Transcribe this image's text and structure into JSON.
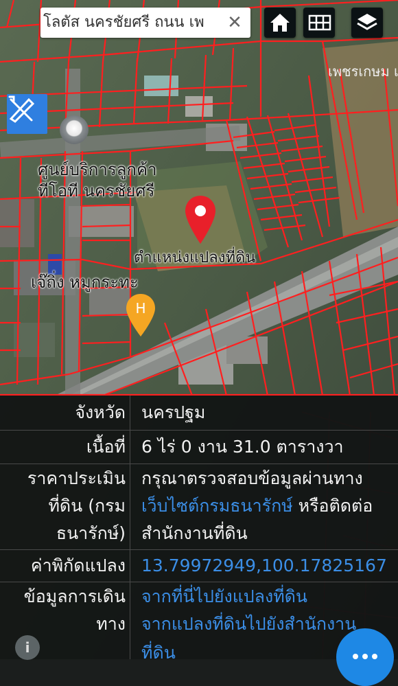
{
  "search": {
    "value": "โลตัส นครชัยศรี ถนน เพ",
    "clear_label": "✕"
  },
  "toolbar": {
    "home_icon": "home-icon",
    "grid_icon": "grid-icon",
    "layers_icon": "layers-icon"
  },
  "map": {
    "labels": {
      "poi_a_line1": "ศูนย์บริการลูกค้า",
      "poi_a_line2": "ทีโอที นครชัยศรี",
      "parcel_label": "ตำแหน่งแปลงที่ดิน",
      "poi_b": "เจ๊ถิ่ง หมูกระทะ",
      "road_top": "เพชรเกษม เพ"
    },
    "colors": {
      "parcel_lines": "#ff1f1f",
      "pin_red": "#e8202a",
      "pin_yellow": "#f5a623",
      "tool_blue": "#2f7fe0"
    },
    "yellow_pin_glyph": "H"
  },
  "info_panel": {
    "province_label": "จังหวัด",
    "province_value": "นครปฐม",
    "area_label": "เนื้อที่",
    "area_value": "6 ไร่ 0 งาน 31.0 ตารางวา",
    "price_label_1": "ราคาประเมิน",
    "price_label_2": "ที่ดิน (กรม",
    "price_label_3": "ธนารักษ์)",
    "price_value_1": "กรุณาตรวจสอบข้อมูลผ่านทาง",
    "price_link": "เว็บไซต์กรมธนารักษ์",
    "price_value_2": " หรือติดต่อ",
    "price_value_3": "สำนักงานที่ดิน",
    "coord_label": "ค่าพิกัดแปลง",
    "coord_value": "13.79972949,100.17825167",
    "route_label_1": "ข้อมูลการเดิน",
    "route_label_2": "ทาง",
    "route_link_1": "จากที่นี่ไปยังแปลงที่ดิน",
    "route_link_2a": "จากแปลงที่ดินไปยังสำนักงาน",
    "route_link_2b": "ที่ดิน"
  },
  "fab": {
    "icon": "more-dots-icon"
  },
  "info_button": {
    "glyph": "i"
  }
}
